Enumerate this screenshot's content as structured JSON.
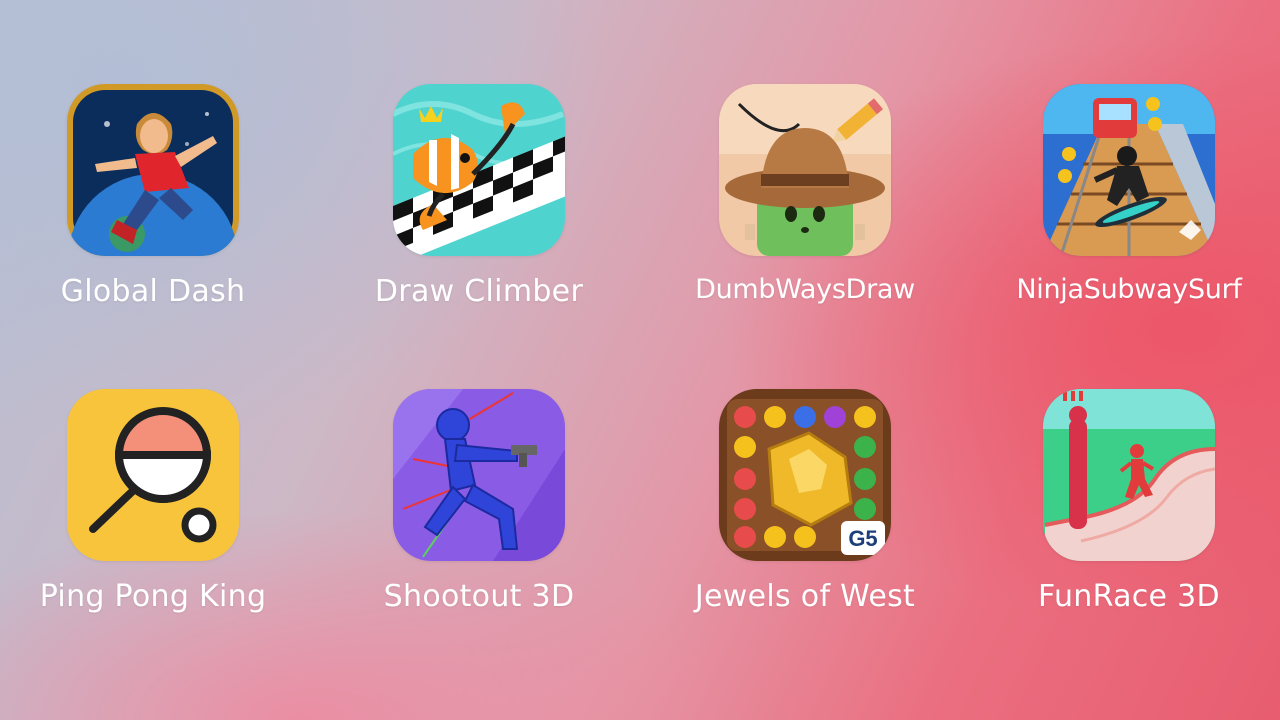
{
  "apps": [
    {
      "label": "Global Dash",
      "icon": "global-dash-app-icon"
    },
    {
      "label": "Draw Climber",
      "icon": "draw-climber-app-icon"
    },
    {
      "label": "DumbWaysDraw",
      "icon": "dumb-ways-draw-app-icon"
    },
    {
      "label": "NinjaSubwaySurf",
      "icon": "ninja-subway-surf-app-icon"
    },
    {
      "label": "Ping Pong King",
      "icon": "ping-pong-king-app-icon"
    },
    {
      "label": "Shootout 3D",
      "icon": "shootout-3d-app-icon"
    },
    {
      "label": "Jewels of West",
      "icon": "jewels-of-west-app-icon",
      "badge": "G5"
    },
    {
      "label": "FunRace 3D",
      "icon": "funrace-3d-app-icon"
    }
  ],
  "colors": {
    "label_text": "#ffffff",
    "ping_pong_bg": "#f7c43c",
    "paddle": "#f4907a",
    "shootout_bg": "#8a5ce6",
    "stickman": "#2f44d8"
  }
}
